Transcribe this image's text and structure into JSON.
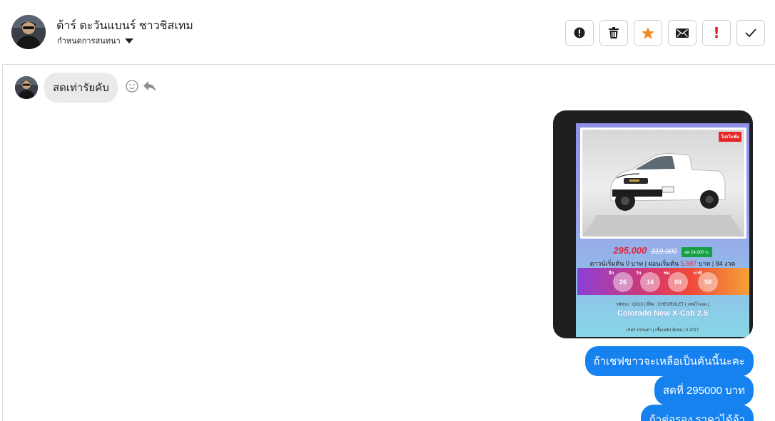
{
  "header": {
    "contact_name": "ต้าร์ ตะวันแบนร์ ชาวชิสเทม",
    "assign_label": "กำหนดการสนทนา",
    "actions": [
      {
        "icon": "exclamation-circle-icon"
      },
      {
        "icon": "trash-icon"
      },
      {
        "icon": "star-icon",
        "color": "#f08a24"
      },
      {
        "icon": "envelope-icon"
      },
      {
        "icon": "exclamation-icon",
        "text": "!",
        "color": "#e02020"
      },
      {
        "icon": "check-icon"
      }
    ]
  },
  "thread": {
    "incoming": {
      "text": "สดเท่ารัยคับ"
    },
    "image_message": {
      "promo_tag": "โปรโมชั่น",
      "price": "295,000",
      "old_price": "319,000",
      "discount": "ลด 24,000 บ.",
      "down_text_1": "ดาวน์เริ่มต้น 0 บาท | ผ่อนเริ่มต้น ",
      "installment": "5,597",
      "down_text_2": " บาท | 84 งวด",
      "countdown": [
        {
          "label": "อีก",
          "value": "26"
        },
        {
          "label": "วัน",
          "value": "14"
        },
        {
          "label": "ชม.",
          "value": "00"
        },
        {
          "label": "นาที",
          "value": "58"
        }
      ],
      "spec_line": "รหัสรถ : Q013 | ยี่ห้อ : CHEVROLET ( เชฟโรเลต )",
      "model": "Colorado New X-Cab 2.5",
      "footer_line": "เกียร์ ธรรมดา | เชื้อเพลิง ดีเซล | 0 2017"
    },
    "outgoing": [
      "ถ้าเชฟขาวจะเหลือเป็นคันนี้นะคะ",
      "สดที่ 295000 บาท",
      "ถ้าต่อรอง ราคาได้จ้า"
    ]
  },
  "colors": {
    "outgoing_bubble": "#1582f0",
    "incoming_bubble": "#e9eaeb",
    "star": "#f08a24",
    "alert": "#e02020"
  }
}
